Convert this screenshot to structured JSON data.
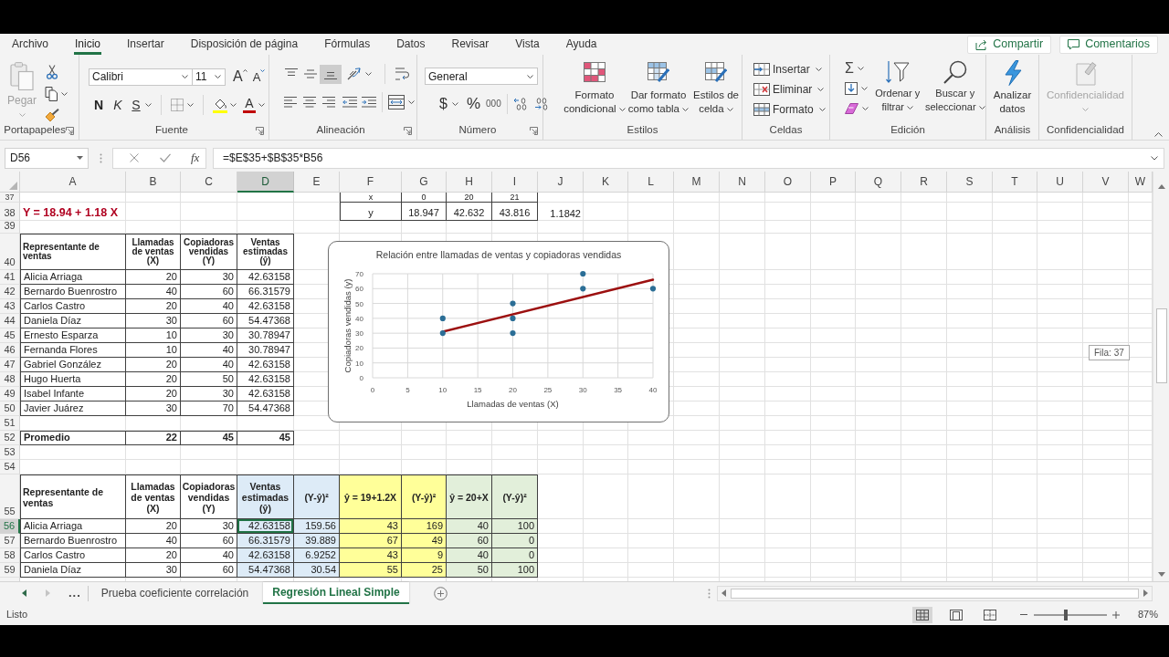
{
  "ribbon": {
    "tabs": [
      {
        "label": "Archivo",
        "selected": false
      },
      {
        "label": "Inicio",
        "selected": true
      },
      {
        "label": "Insertar",
        "selected": false
      },
      {
        "label": "Disposición de página",
        "selected": false
      },
      {
        "label": "Fórmulas",
        "selected": false
      },
      {
        "label": "Datos",
        "selected": false
      },
      {
        "label": "Revisar",
        "selected": false
      },
      {
        "label": "Vista",
        "selected": false
      },
      {
        "label": "Ayuda",
        "selected": false
      }
    ],
    "share_button": "Compartir",
    "comments_button": "Comentarios",
    "clipboard": {
      "label": "Portapapeles",
      "paste": {
        "label": "Pegar",
        "disabled": true
      }
    },
    "font": {
      "label": "Fuente",
      "font_name": "Calibri",
      "font_size": "11",
      "grow_font": "A",
      "shrink_font": "A",
      "bold": "N",
      "italic": "K",
      "underline": "S",
      "font_color": "A"
    },
    "alignment": {
      "label": "Alineación",
      "vertical_align": [
        {
          "kind": "top",
          "selected": false
        },
        {
          "kind": "middle",
          "selected": false
        },
        {
          "kind": "bottom",
          "selected": true
        }
      ]
    },
    "number": {
      "label": "Número",
      "format": "General",
      "currency": "$",
      "percent": "%",
      "thousands": "000"
    },
    "styles": {
      "label": "Estilos",
      "buttons": [
        {
          "kind": "conditional",
          "label": "Formato condicional"
        },
        {
          "kind": "table",
          "label": "Dar formato como tabla"
        },
        {
          "kind": "cell_styles",
          "label": "Estilos de celda"
        }
      ]
    },
    "cells": {
      "label": "Celdas",
      "buttons": [
        {
          "kind": "insert",
          "label": "Insertar"
        },
        {
          "kind": "delete",
          "label": "Eliminar"
        },
        {
          "kind": "format",
          "label": "Formato"
        }
      ]
    },
    "editing": {
      "label": "Edición",
      "autosum": "Σ",
      "buttons": [
        {
          "kind": "sort",
          "label": "Ordenar y filtrar"
        },
        {
          "kind": "find",
          "label": "Buscar y seleccionar"
        }
      ]
    },
    "analysis": {
      "label": "Análisis",
      "button": "Analizar datos"
    },
    "sensitivity": {
      "label": "Confidencialidad",
      "button": {
        "label": "Confidencialidad",
        "disabled": true
      }
    }
  },
  "formula_bar": {
    "name_box": "D56",
    "insert_function": "fx",
    "formula": "=$E$35+$B$35*B56"
  },
  "sheet": {
    "columns": [
      {
        "label": "A",
        "selected": false
      },
      {
        "label": "B",
        "selected": false
      },
      {
        "label": "C",
        "selected": false
      },
      {
        "label": "D",
        "selected": true
      },
      {
        "label": "E",
        "selected": false
      },
      {
        "label": "F",
        "selected": false
      },
      {
        "label": "G",
        "selected": false
      },
      {
        "label": "H",
        "selected": false
      },
      {
        "label": "I",
        "selected": false
      },
      {
        "label": "J",
        "selected": false
      },
      {
        "label": "K",
        "selected": false
      },
      {
        "label": "L",
        "selected": false
      },
      {
        "label": "M",
        "selected": false
      },
      {
        "label": "N",
        "selected": false
      },
      {
        "label": "O",
        "selected": false
      },
      {
        "label": "P",
        "selected": false
      },
      {
        "label": "Q",
        "selected": false
      },
      {
        "label": "R",
        "selected": false
      },
      {
        "label": "S",
        "selected": false
      },
      {
        "label": "T",
        "selected": false
      },
      {
        "label": "U",
        "selected": false
      },
      {
        "label": "V",
        "selected": false
      },
      {
        "label": "W",
        "selected": false
      }
    ],
    "rows": [
      {
        "label": "37",
        "selected": false
      },
      {
        "label": "38",
        "selected": false
      },
      {
        "label": "39",
        "selected": false
      },
      {
        "label": "40",
        "selected": false
      },
      {
        "label": "41",
        "selected": false
      },
      {
        "label": "42",
        "selected": false
      },
      {
        "label": "43",
        "selected": false
      },
      {
        "label": "44",
        "selected": false
      },
      {
        "label": "45",
        "selected": false
      },
      {
        "label": "46",
        "selected": false
      },
      {
        "label": "47",
        "selected": false
      },
      {
        "label": "48",
        "selected": false
      },
      {
        "label": "49",
        "selected": false
      },
      {
        "label": "50",
        "selected": false
      },
      {
        "label": "51",
        "selected": false
      },
      {
        "label": "52",
        "selected": false
      },
      {
        "label": "53",
        "selected": false
      },
      {
        "label": "54",
        "selected": false
      },
      {
        "label": "55",
        "selected": false
      },
      {
        "label": "56",
        "selected": true
      },
      {
        "label": "57",
        "selected": false
      },
      {
        "label": "58",
        "selected": false
      },
      {
        "label": "59",
        "selected": false
      }
    ],
    "equation": "Y = 18.94 + 1.18 X",
    "line_points": [
      [
        "x",
        "0",
        "20",
        "21"
      ],
      [
        "y",
        "18.947",
        "42.632",
        "43.816"
      ]
    ],
    "slope": "1.1842",
    "table_1": {
      "columns": [
        "Representante de ventas",
        "Llamadas de ventas (X)",
        "Copiadoras vendidas (Y)",
        "Ventas estimadas (ŷ)"
      ],
      "rows": [
        [
          "Alicia Arriaga",
          "20",
          "30",
          "42.63158"
        ],
        [
          "Bernardo Buenrostro",
          "40",
          "60",
          "66.31579"
        ],
        [
          "Carlos Castro",
          "20",
          "40",
          "42.63158"
        ],
        [
          "Daniela Díaz",
          "30",
          "60",
          "54.47368"
        ],
        [
          "Ernesto Esparza",
          "10",
          "30",
          "30.78947"
        ],
        [
          "Fernanda Flores",
          "10",
          "40",
          "30.78947"
        ],
        [
          "Gabriel González",
          "20",
          "40",
          "42.63158"
        ],
        [
          "Hugo Huerta",
          "20",
          "50",
          "42.63158"
        ],
        [
          "Isabel Infante",
          "20",
          "30",
          "42.63158"
        ],
        [
          "Javier Juárez",
          "30",
          "70",
          "54.47368"
        ]
      ],
      "average": [
        "Promedio",
        "22",
        "45",
        "45"
      ]
    },
    "chart": {
      "chart_data": [
        {
          "type": "scatter",
          "title": "Relación entre llamadas de ventas y copiadoras vendidas",
          "xlabel": "Llamadas de ventas (X)",
          "ylabel": "Copiadoras vendidas (y)",
          "xlim": [
            0,
            40
          ],
          "ylim": [
            0,
            70
          ],
          "xticks": [
            0,
            5,
            10,
            15,
            20,
            25,
            30,
            35,
            40
          ],
          "yticks": [
            0,
            10,
            20,
            30,
            40,
            50,
            60,
            70
          ],
          "grid": true,
          "series": [
            {
              "type": "scatter",
              "color": "#2b6e96",
              "x": [
                20,
                40,
                20,
                30,
                10,
                10,
                20,
                30
              ],
              "values": [
                30,
                60,
                40,
                60,
                30,
                40,
                50,
                70
              ]
            },
            {
              "type": "line",
              "color": "#9c1010",
              "x": [
                10,
                40
              ],
              "values": [
                31,
                66
              ]
            }
          ]
        }
      ]
    },
    "table_2": {
      "columns": [
        {
          "label": "Representante de ventas"
        },
        {
          "label": "Llamadas de ventas (X)"
        },
        {
          "label": "Copiadoras vendidas (Y)"
        },
        {
          "label": "Ventas estimadas (ŷ)",
          "color": "#ddebf7"
        },
        {
          "label": "(Y-ŷ)²",
          "color": "#ddebf7"
        },
        {
          "label": "ŷ = 19+1.2X",
          "color": "#ffff99"
        },
        {
          "label": "(Y-ŷ)²",
          "color": "#ffff99"
        },
        {
          "label": "ŷ = 20+X",
          "color": "#e2efda"
        },
        {
          "label": "(Y-ŷ)²",
          "color": "#e2efda"
        }
      ],
      "rows": [
        [
          "Alicia Arriaga",
          "20",
          "30",
          "42.63158",
          "159.56",
          "43",
          "169",
          "40",
          "100"
        ],
        [
          "Bernardo Buenrostro",
          "40",
          "60",
          "66.31579",
          "39.889",
          "67",
          "49",
          "60",
          "0"
        ],
        [
          "Carlos Castro",
          "20",
          "40",
          "42.63158",
          "6.9252",
          "43",
          "9",
          "40",
          "0"
        ],
        [
          "Daniela Díaz",
          "30",
          "60",
          "54.47368",
          "30.54",
          "55",
          "25",
          "50",
          "100"
        ]
      ]
    },
    "row_tooltip": "Fila: 37"
  },
  "sheet_tabs": {
    "more": "...",
    "tabs": [
      {
        "label": "Prueba coeficiente correlación",
        "selected": false
      },
      {
        "label": "Regresión Lineal Simple",
        "selected": true
      }
    ]
  },
  "status_bar": {
    "status": "Listo",
    "views": [
      {
        "kind": "normal",
        "selected": true
      },
      {
        "kind": "page_layout",
        "selected": false
      },
      {
        "kind": "page_break",
        "selected": false
      }
    ],
    "zoom": {
      "level": 0.44,
      "label": "87%"
    }
  }
}
